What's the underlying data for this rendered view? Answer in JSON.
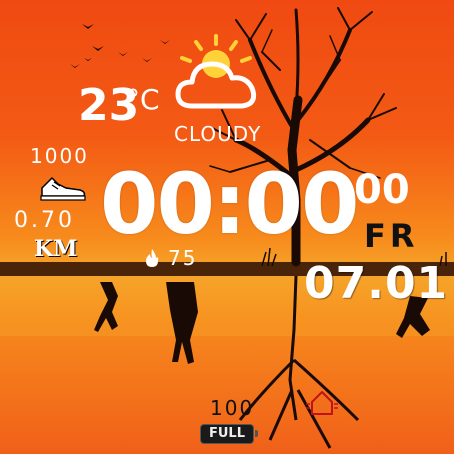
{
  "weather": {
    "temperature": "23",
    "unit": "°C",
    "condition": "CLOUDY",
    "icon": "sun-behind-cloud-icon"
  },
  "steps": {
    "value": "1000",
    "icon": "sneaker-icon"
  },
  "distance": {
    "value": "0.70",
    "unit": "KM"
  },
  "calories": {
    "value": "75",
    "icon": "flame-icon"
  },
  "time": {
    "hours": "00",
    "minutes": "00",
    "seconds": "00"
  },
  "date": {
    "day_of_week": "FR",
    "date": "07.01"
  },
  "battery": {
    "value": "100",
    "status": "FULL"
  },
  "icons": {
    "home": "home-icon"
  },
  "colors": {
    "sky_top": "#f04a12",
    "horizon": "#f6a52a",
    "silhouette": "#1a0a05",
    "text": "#ffffff",
    "date_text": "#111111"
  }
}
